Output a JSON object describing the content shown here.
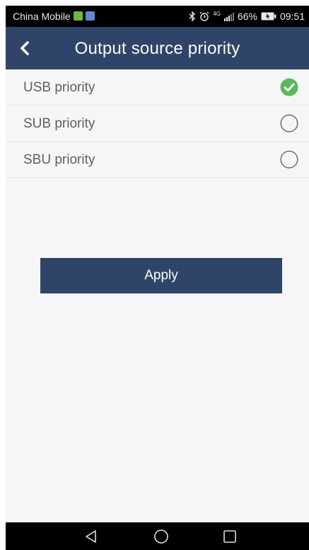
{
  "status_bar": {
    "carrier": "China Mobile",
    "network": "4G",
    "battery": "66%",
    "time": "09:51",
    "icons": [
      "notification-green-icon",
      "notification-blue-icon",
      "bluetooth-icon",
      "alarm-icon",
      "signal-icon",
      "battery-icon"
    ]
  },
  "header": {
    "title": "Output source priority",
    "back_icon": "chevron-left-icon"
  },
  "options": [
    {
      "label": "USB priority",
      "selected": true
    },
    {
      "label": "SUB priority",
      "selected": false
    },
    {
      "label": "SBU priority",
      "selected": false
    }
  ],
  "apply_label": "Apply",
  "nav_bar": {
    "icons": [
      "back-triangle-icon",
      "home-circle-icon",
      "recents-square-icon"
    ]
  },
  "colors": {
    "header": "#2e4468",
    "check": "#5cb85c",
    "background": "#f6f6f8"
  }
}
